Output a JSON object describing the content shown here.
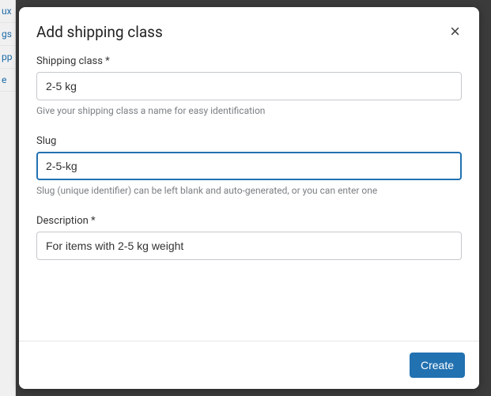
{
  "modal": {
    "title": "Add shipping class",
    "close_label": "×",
    "fields": {
      "name": {
        "label": "Shipping class *",
        "value": "2-5 kg",
        "help": "Give your shipping class a name for easy identification"
      },
      "slug": {
        "label": "Slug",
        "value": "2-5-kg",
        "help": "Slug (unique identifier) can be left blank and auto-generated, or you can enter one"
      },
      "description": {
        "label": "Description *",
        "value": "For items with 2-5 kg weight"
      }
    },
    "footer": {
      "submit_label": "Create"
    }
  },
  "background": {
    "items": [
      "ux",
      "gs",
      "pp",
      "e"
    ]
  }
}
